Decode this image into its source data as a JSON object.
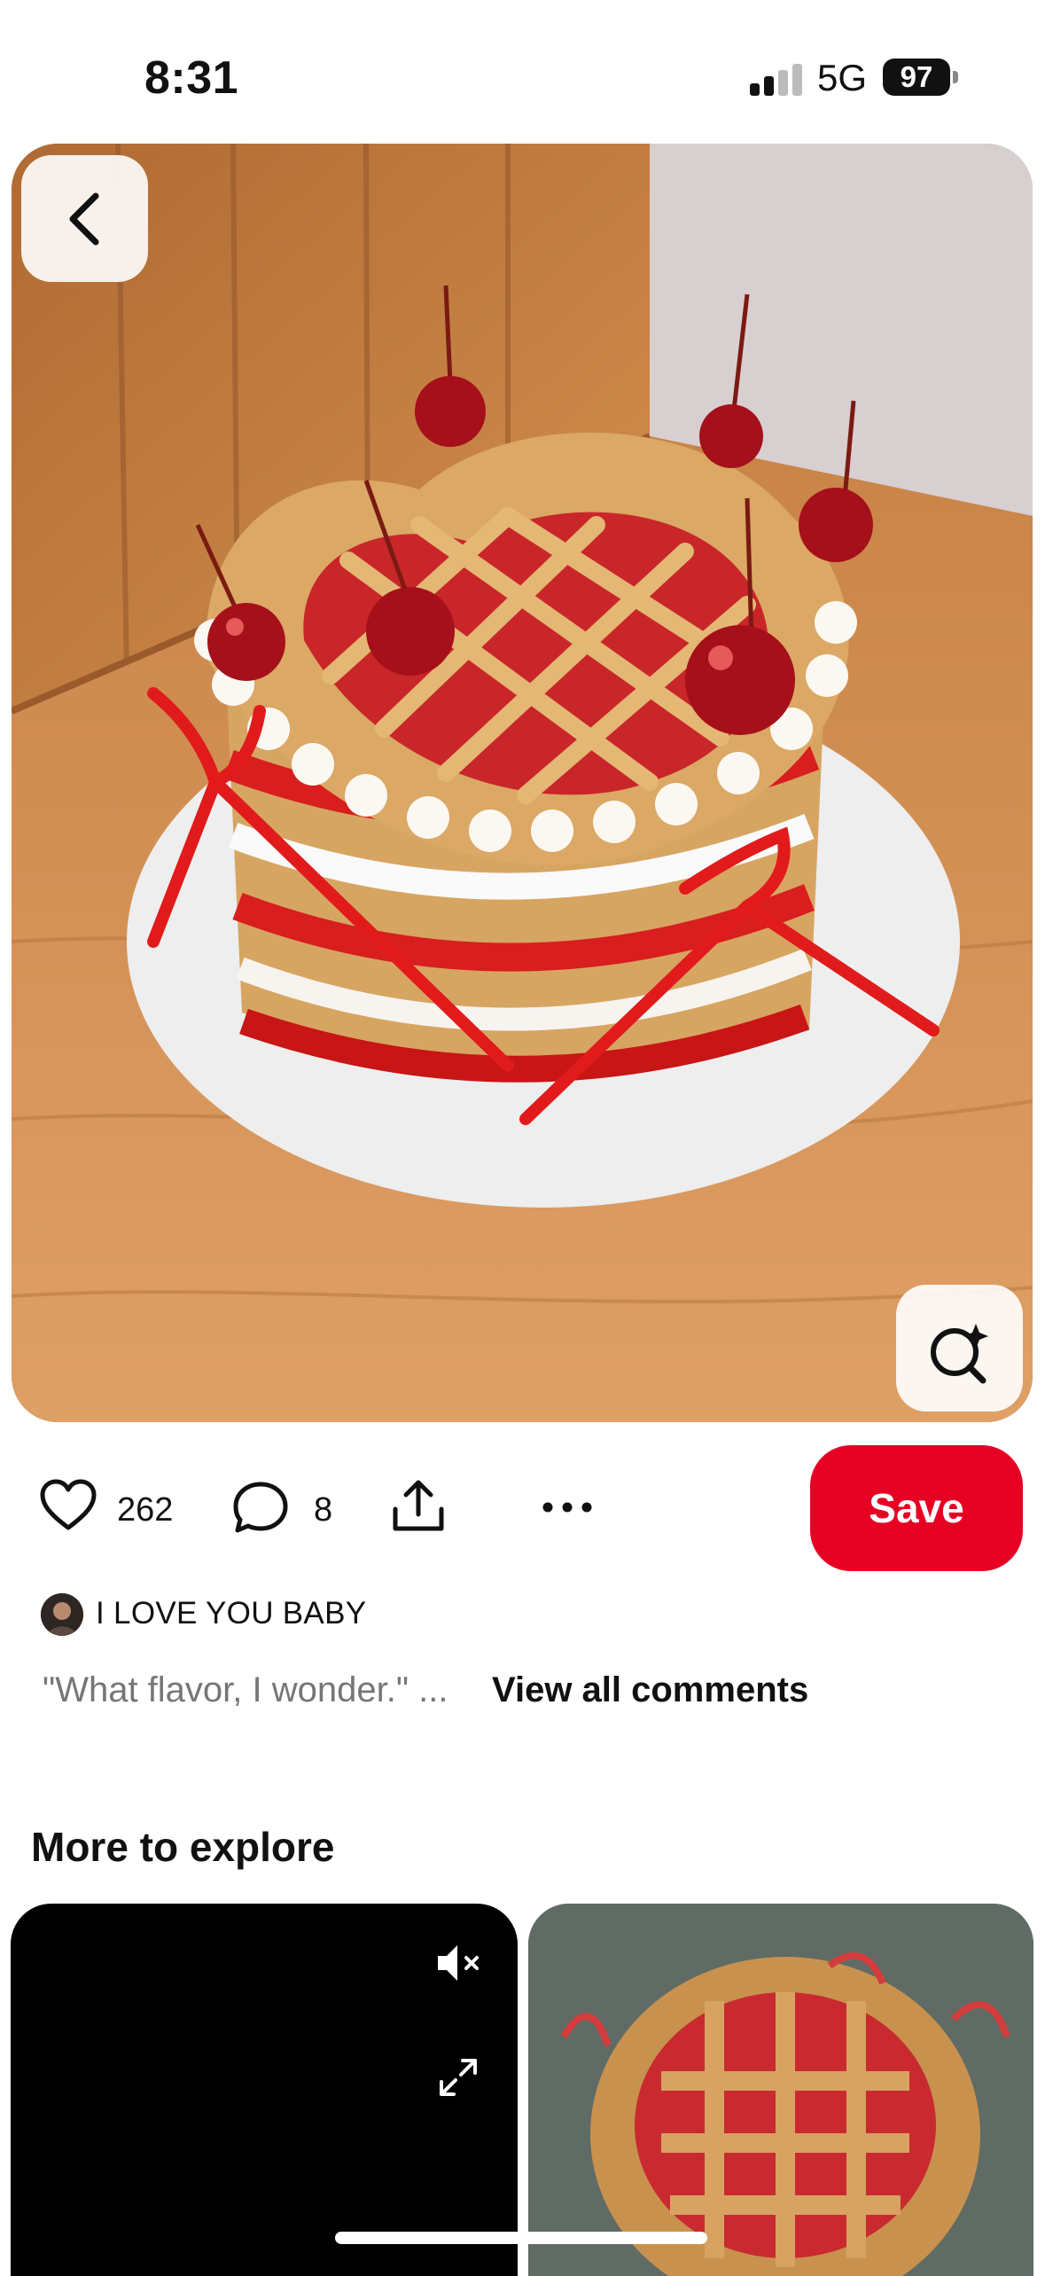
{
  "status_bar": {
    "time": "8:31",
    "network": "5G",
    "battery": "97",
    "signal_bars_active": 2
  },
  "pin": {
    "image_alt": "Heart shaped cherry pie cake with red bows and cherries",
    "back_icon": "chevron-left-icon",
    "visual_search_icon": "lens-sparkle-icon"
  },
  "actions": {
    "like_count": "262",
    "comment_count": "8",
    "save_label": "Save"
  },
  "author": {
    "name": "I LOVE YOU BABY"
  },
  "comments": {
    "preview": "\"What flavor, I wonder.\" ...",
    "view_all_label": "View all comments"
  },
  "more_to_explore": {
    "title": "More to explore"
  },
  "colors": {
    "accent": "#e60023",
    "muted_text": "#767676"
  }
}
